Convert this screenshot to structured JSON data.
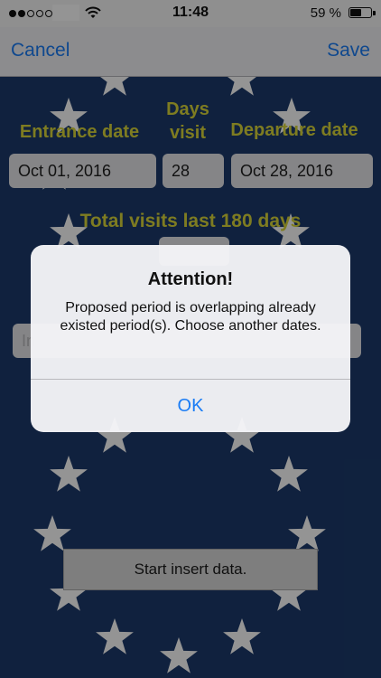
{
  "status_bar": {
    "signal_bars_filled": 2,
    "signal_bars_total": 5,
    "time": "11:48",
    "battery_percent_label": "59 %",
    "battery_level": 0.59
  },
  "nav": {
    "cancel_label": "Cancel",
    "save_label": "Save"
  },
  "form": {
    "entrance_label": "Entrance date",
    "days_label": "Days visit",
    "departure_label": "Departure date",
    "entrance_value": "Oct 01, 2016",
    "days_value": "28",
    "departure_value": "Oct 28, 2016",
    "total_label": "Total visits last 180 days",
    "total_value": "",
    "insert_placeholder_partial": "In",
    "start_button_label": "Start insert data."
  },
  "alert": {
    "title": "Attention!",
    "message": "Proposed period is overlapping already existed period(s). Choose another dates.",
    "ok_label": "OK"
  },
  "colors": {
    "background": "#1c3a6b",
    "star": "#ffffff",
    "label_yellow": "#d9d63a",
    "ios_blue": "#1a7cf5"
  },
  "icons": {
    "wifi": "wifi-icon",
    "battery": "battery-icon",
    "signal": "signal-dots-icon",
    "background_star": "star-icon"
  }
}
